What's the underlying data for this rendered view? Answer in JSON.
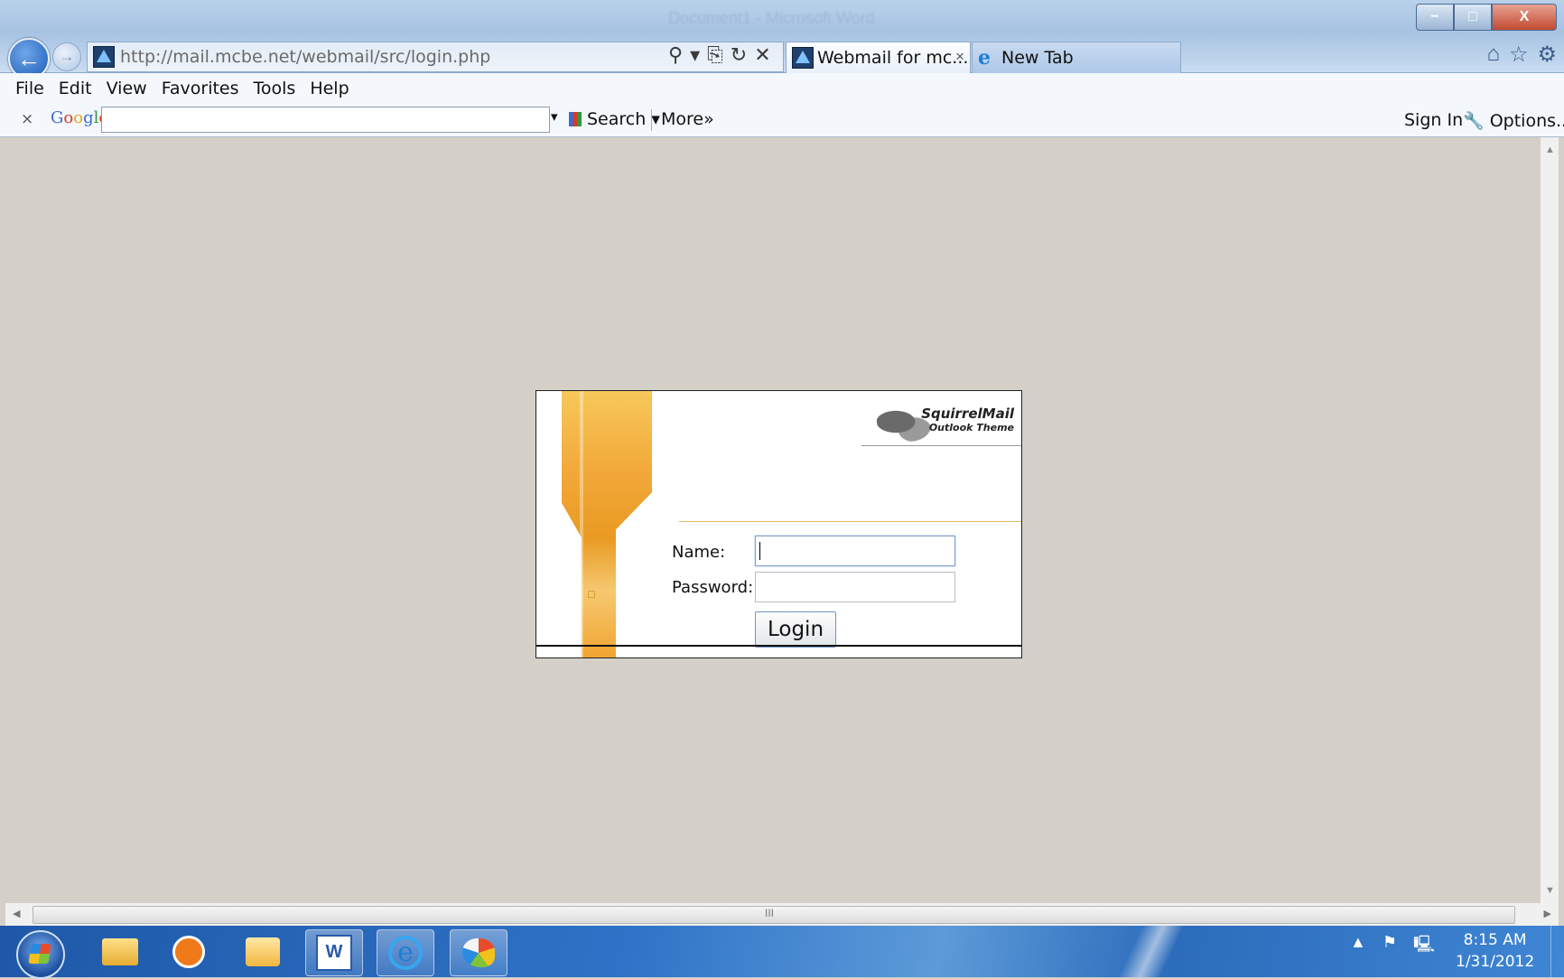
{
  "window": {
    "title": "Document1 - Microsoft Word",
    "controls": {
      "minimize": "−",
      "maximize": "□",
      "close": "X"
    }
  },
  "browser": {
    "address_url": "http://mail.mcbe.net/webmail/src/login.php",
    "tabs": [
      {
        "label": "Webmail for mc...",
        "close": "×",
        "active": true
      },
      {
        "label": "New Tab",
        "active": false
      }
    ],
    "address_tools": {
      "search": "⚲",
      "dropdown": "▾",
      "compat": "⎘",
      "refresh": "↻",
      "stop": "✕"
    },
    "right_icons": {
      "home": "⌂",
      "favorites": "☆",
      "tools": "⚙"
    },
    "menu": [
      "File",
      "Edit",
      "View",
      "Favorites",
      "Tools",
      "Help"
    ],
    "google_toolbar": {
      "close": "×",
      "logo_letters": [
        "G",
        "o",
        "o",
        "g",
        "l",
        "e"
      ],
      "dropdown": "▾",
      "search_label": "Search ▾",
      "more_label": "More»",
      "signin_label": "Sign In",
      "options_label": "🔧 Options... ▾"
    }
  },
  "login": {
    "brand_title": "SquirrelMail",
    "brand_subtitle": "Outlook Theme",
    "name_label": "Name:",
    "password_label": "Password:",
    "name_value": "",
    "password_value": "",
    "login_button": "Login"
  },
  "scrollbar": {
    "up": "▲",
    "down": "▼",
    "left": "◀",
    "right": "▶",
    "grip": "III"
  },
  "taskbar": {
    "items": [
      "explorer",
      "media-player",
      "outlook",
      "word",
      "internet-explorer",
      "paint"
    ],
    "word_glyph": "W",
    "ie_glyph": "e",
    "tray": {
      "expand": "▲",
      "flag": "⚑",
      "network": "🖳"
    },
    "clock_time": "8:15 AM",
    "clock_date": "1/31/2012"
  }
}
